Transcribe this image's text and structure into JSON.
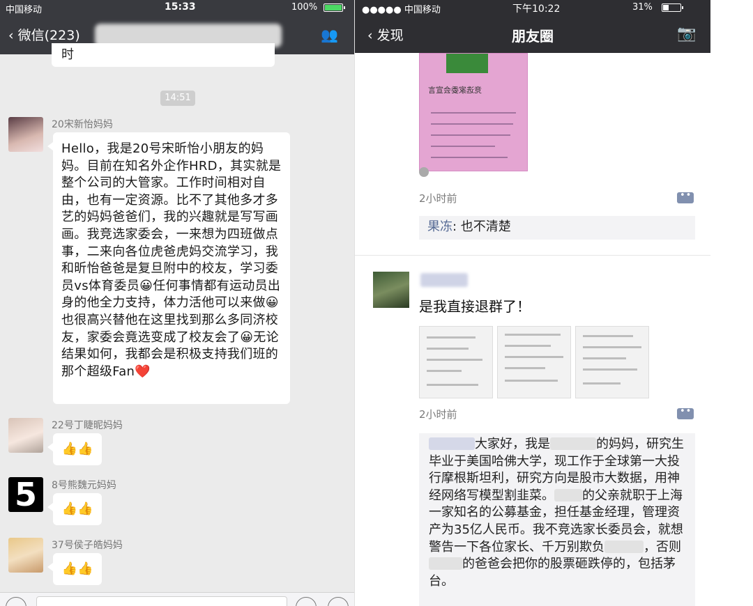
{
  "left_phone": {
    "status": {
      "carrier": "中国移动",
      "time": "15:33",
      "battery": "100%"
    },
    "nav": {
      "back_label": "微信(223)"
    },
    "previous_text": "时",
    "time_divider": "14:51",
    "messages": [
      {
        "sender": "20宋新怡妈妈",
        "text": "Hello，我是20号宋昕怡小朋友的妈妈。目前在知名外企作HRD，其实就是整个公司的大管家。工作时间相对自由，也有一定资源。比不了其他多才多艺的妈妈爸爸们，我的兴趣就是写写画画。我竞选家委会，一来想为四班做点事，二来向各位虎爸虎妈交流学习，我和昕怡爸爸是复旦附中的校友，学习委员vs体育委员😀任何事情都有运动员出身的他全力支持，体力活他可以来做😀也很高兴替他在这里找到那么多同济校友，家委会竟选变成了校友会了😀无论结果如何，我都会是积极支持我们班的那个超级Fan❤️"
      },
      {
        "sender": "22号丁睫昵妈妈",
        "text": "👍👍"
      },
      {
        "sender": "8号熊魏元妈妈",
        "text": "👍👍",
        "avatar_text": "5"
      },
      {
        "sender": "37号侯子皓妈妈",
        "text": "👍👍"
      }
    ]
  },
  "right_phone": {
    "status": {
      "carrier": "●●●●● 中国移动",
      "time": "下午10:22",
      "battery": "31%"
    },
    "nav": {
      "back_label": "发现",
      "title": "朋友圈"
    },
    "post1": {
      "poster_title": "竞选家委会宣言",
      "time": "2小时前",
      "comment_name": "果冻",
      "comment_text": ": 也不清楚"
    },
    "post2": {
      "text": "是我直接退群了！",
      "time": "2小时前",
      "comment_text_1": "大家好，我是",
      "comment_text_2": "的妈妈，研究生毕业于美国哈佛大学，现工作于全球第一大投行摩根斯坦利，研究方向是股市大数据，用神经网络写模型割韭菜。",
      "comment_text_3": "的父亲就职于上海一家知名的公募基金，担任基金经理，管理资产为35亿人民币。我不竞选家长委员会，就想警告一下各位家长、千万别欺负",
      "comment_text_4": "，否则",
      "comment_text_5": "的爸爸会把你的股票砸跌停的，包括茅台。"
    }
  }
}
